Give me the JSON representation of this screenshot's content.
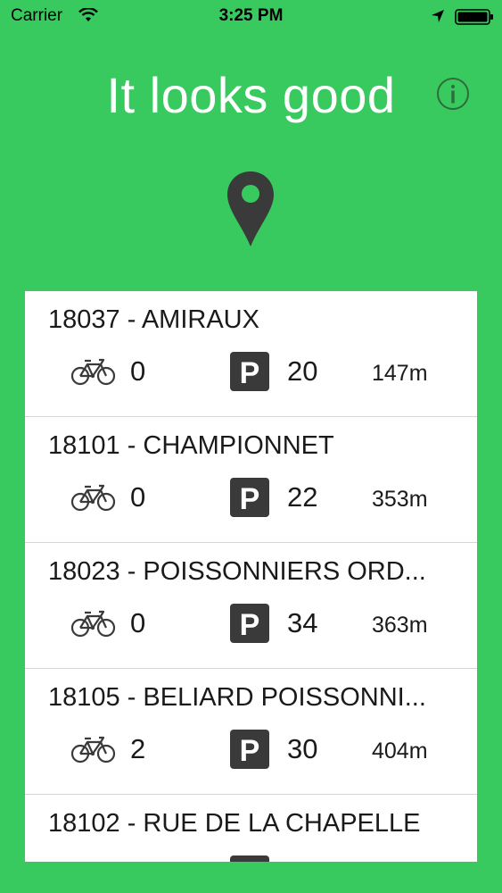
{
  "status_bar": {
    "carrier": "Carrier",
    "time": "3:25 PM"
  },
  "header": {
    "title": "It looks good",
    "info_icon": "info-icon",
    "pin_icon": "map-pin-icon"
  },
  "colors": {
    "background": "#38c95f",
    "card": "#ffffff",
    "icon_dark": "#3a3a3a"
  },
  "stations": [
    {
      "name": "18037 - AMIRAUX",
      "bikes": "0",
      "parking": "20",
      "distance": "147m"
    },
    {
      "name": "18101 - CHAMPIONNET",
      "bikes": "0",
      "parking": "22",
      "distance": "353m"
    },
    {
      "name": "18023 - POISSONNIERS ORD...",
      "bikes": "0",
      "parking": "34",
      "distance": "363m"
    },
    {
      "name": "18105 - BELIARD POISSONNI...",
      "bikes": "2",
      "parking": "30",
      "distance": "404m"
    },
    {
      "name": "18102 - RUE DE LA CHAPELLE",
      "bikes": "",
      "parking": "",
      "distance": ""
    }
  ]
}
